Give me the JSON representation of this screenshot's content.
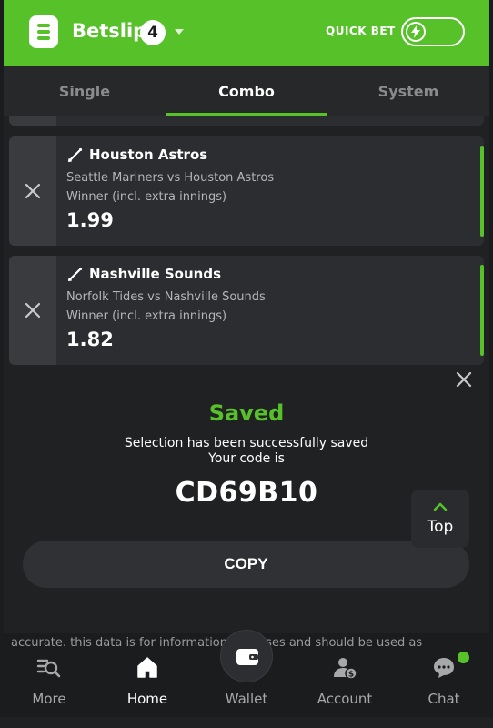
{
  "header": {
    "title": "Betslip",
    "count": "4",
    "quick_bet_label": "QUICK BET"
  },
  "tabs": [
    {
      "label": "Single"
    },
    {
      "label": "Combo"
    },
    {
      "label": "System"
    }
  ],
  "selections": [
    {
      "team": "Houston Astros",
      "match": "Seattle Mariners vs Houston Astros",
      "market": "Winner (incl. extra innings)",
      "odds": "1.99"
    },
    {
      "team": "Nashville Sounds",
      "match": "Norfolk Tides vs Nashville Sounds",
      "market": "Winner (incl. extra innings)",
      "odds": "1.82"
    }
  ],
  "saved": {
    "title": "Saved",
    "message_line1": "Selection has been successfully saved",
    "message_line2": "Your code is",
    "code": "CD69B10",
    "copy_label": "COPY"
  },
  "top_button": {
    "label": "Top"
  },
  "partial_text": "accurate, this data is for information purposes and should be used as",
  "bottom_nav": [
    {
      "label": "More",
      "icon": "search-list-icon"
    },
    {
      "label": "Home",
      "icon": "home-icon"
    },
    {
      "label": "Wallet",
      "icon": "wallet-icon"
    },
    {
      "label": "Account",
      "icon": "account-icon"
    },
    {
      "label": "Chat",
      "icon": "chat-icon"
    }
  ],
  "colors": {
    "accent": "#57c12a",
    "background": "#1b1c1e",
    "card": "#2c2d30"
  }
}
